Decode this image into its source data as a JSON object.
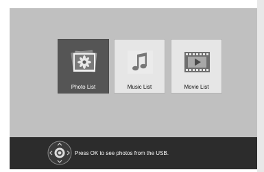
{
  "menu": {
    "tiles": [
      {
        "label": "Photo List",
        "icon": "photo-icon",
        "selected": true
      },
      {
        "label": "Music List",
        "icon": "music-note-icon",
        "selected": false
      },
      {
        "label": "Movie List",
        "icon": "film-icon",
        "selected": false
      }
    ]
  },
  "footer": {
    "hint": "Press OK to see photos from the USB.",
    "control_icon": "dpad-ok-icon"
  },
  "colors": {
    "screen_bg": "#c0c0c0",
    "selected_tile": "#555555",
    "tile": "#e6e6e6",
    "footer_bg": "#2c2c2c"
  }
}
